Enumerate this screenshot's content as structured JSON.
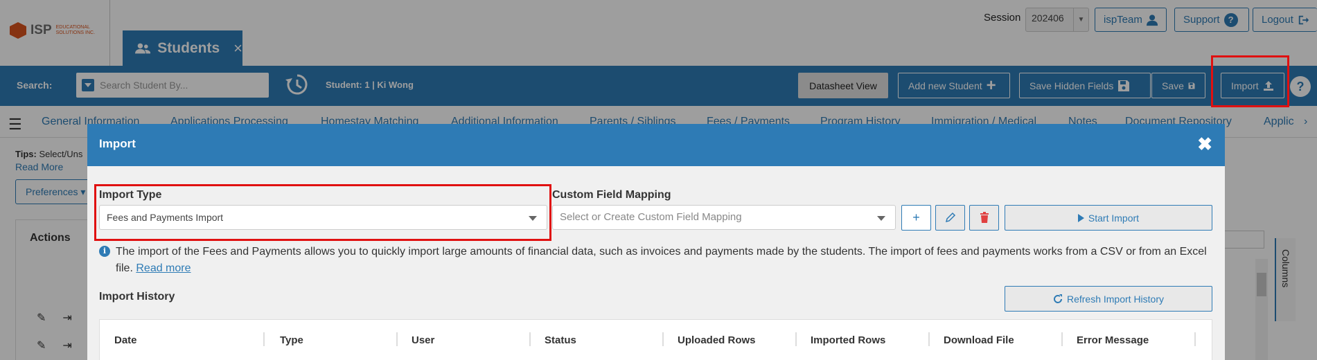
{
  "brand": {
    "logo_text": "ISP",
    "logo_subtext": "EDUCATIONAL SOLUTIONS INC."
  },
  "module_tab": {
    "label": "Students",
    "close": "×"
  },
  "session": {
    "label": "Session",
    "value": "202406"
  },
  "top_buttons": {
    "team": "ispTeam",
    "support": "Support",
    "logout": "Logout"
  },
  "toolbar": {
    "search_label": "Search:",
    "search_placeholder": "Search Student By...",
    "student_info": "Student: 1 | Ki Wong",
    "datasheet": "Datasheet View",
    "add_student": "Add new Student",
    "save_hidden": "Save Hidden Fields",
    "save": "Save",
    "import": "Import",
    "help": "?"
  },
  "nav_tabs": [
    "General Information",
    "Applications Processing",
    "Homestay Matching",
    "Additional Information",
    "Parents / Siblings",
    "Fees / Payments",
    "Program History",
    "Immigration / Medical",
    "Notes",
    "Document Repository",
    "Applic"
  ],
  "background": {
    "tips_label": "Tips:",
    "tips_text": "Select/Uns",
    "read_more": "Read More",
    "preferences": "Preferences",
    "actions_title": "Actions",
    "columns_tab": "Columns"
  },
  "modal": {
    "title": "Import",
    "close": "✖",
    "import_type_label": "Import Type",
    "import_type_value": "Fees and Payments Import",
    "mapping_label": "Custom Field Mapping",
    "mapping_placeholder": "Select or Create Custom Field Mapping",
    "start_import": "Start Import",
    "info_text": "The import of the Fees and Payments allows you to quickly import large amounts of financial data, such as invoices and payments made by the students. The import of fees and payments works from a CSV or from an Excel file.",
    "info_link": "Read more",
    "history_label": "Import History",
    "refresh": "Refresh Import History",
    "columns": [
      "Date",
      "Type",
      "User",
      "Status",
      "Uploaded Rows",
      "Imported Rows",
      "Download File",
      "Error Message"
    ]
  },
  "colors": {
    "primary": "#2e7bb5",
    "highlight": "#e01010",
    "logo": "#d9531e"
  }
}
